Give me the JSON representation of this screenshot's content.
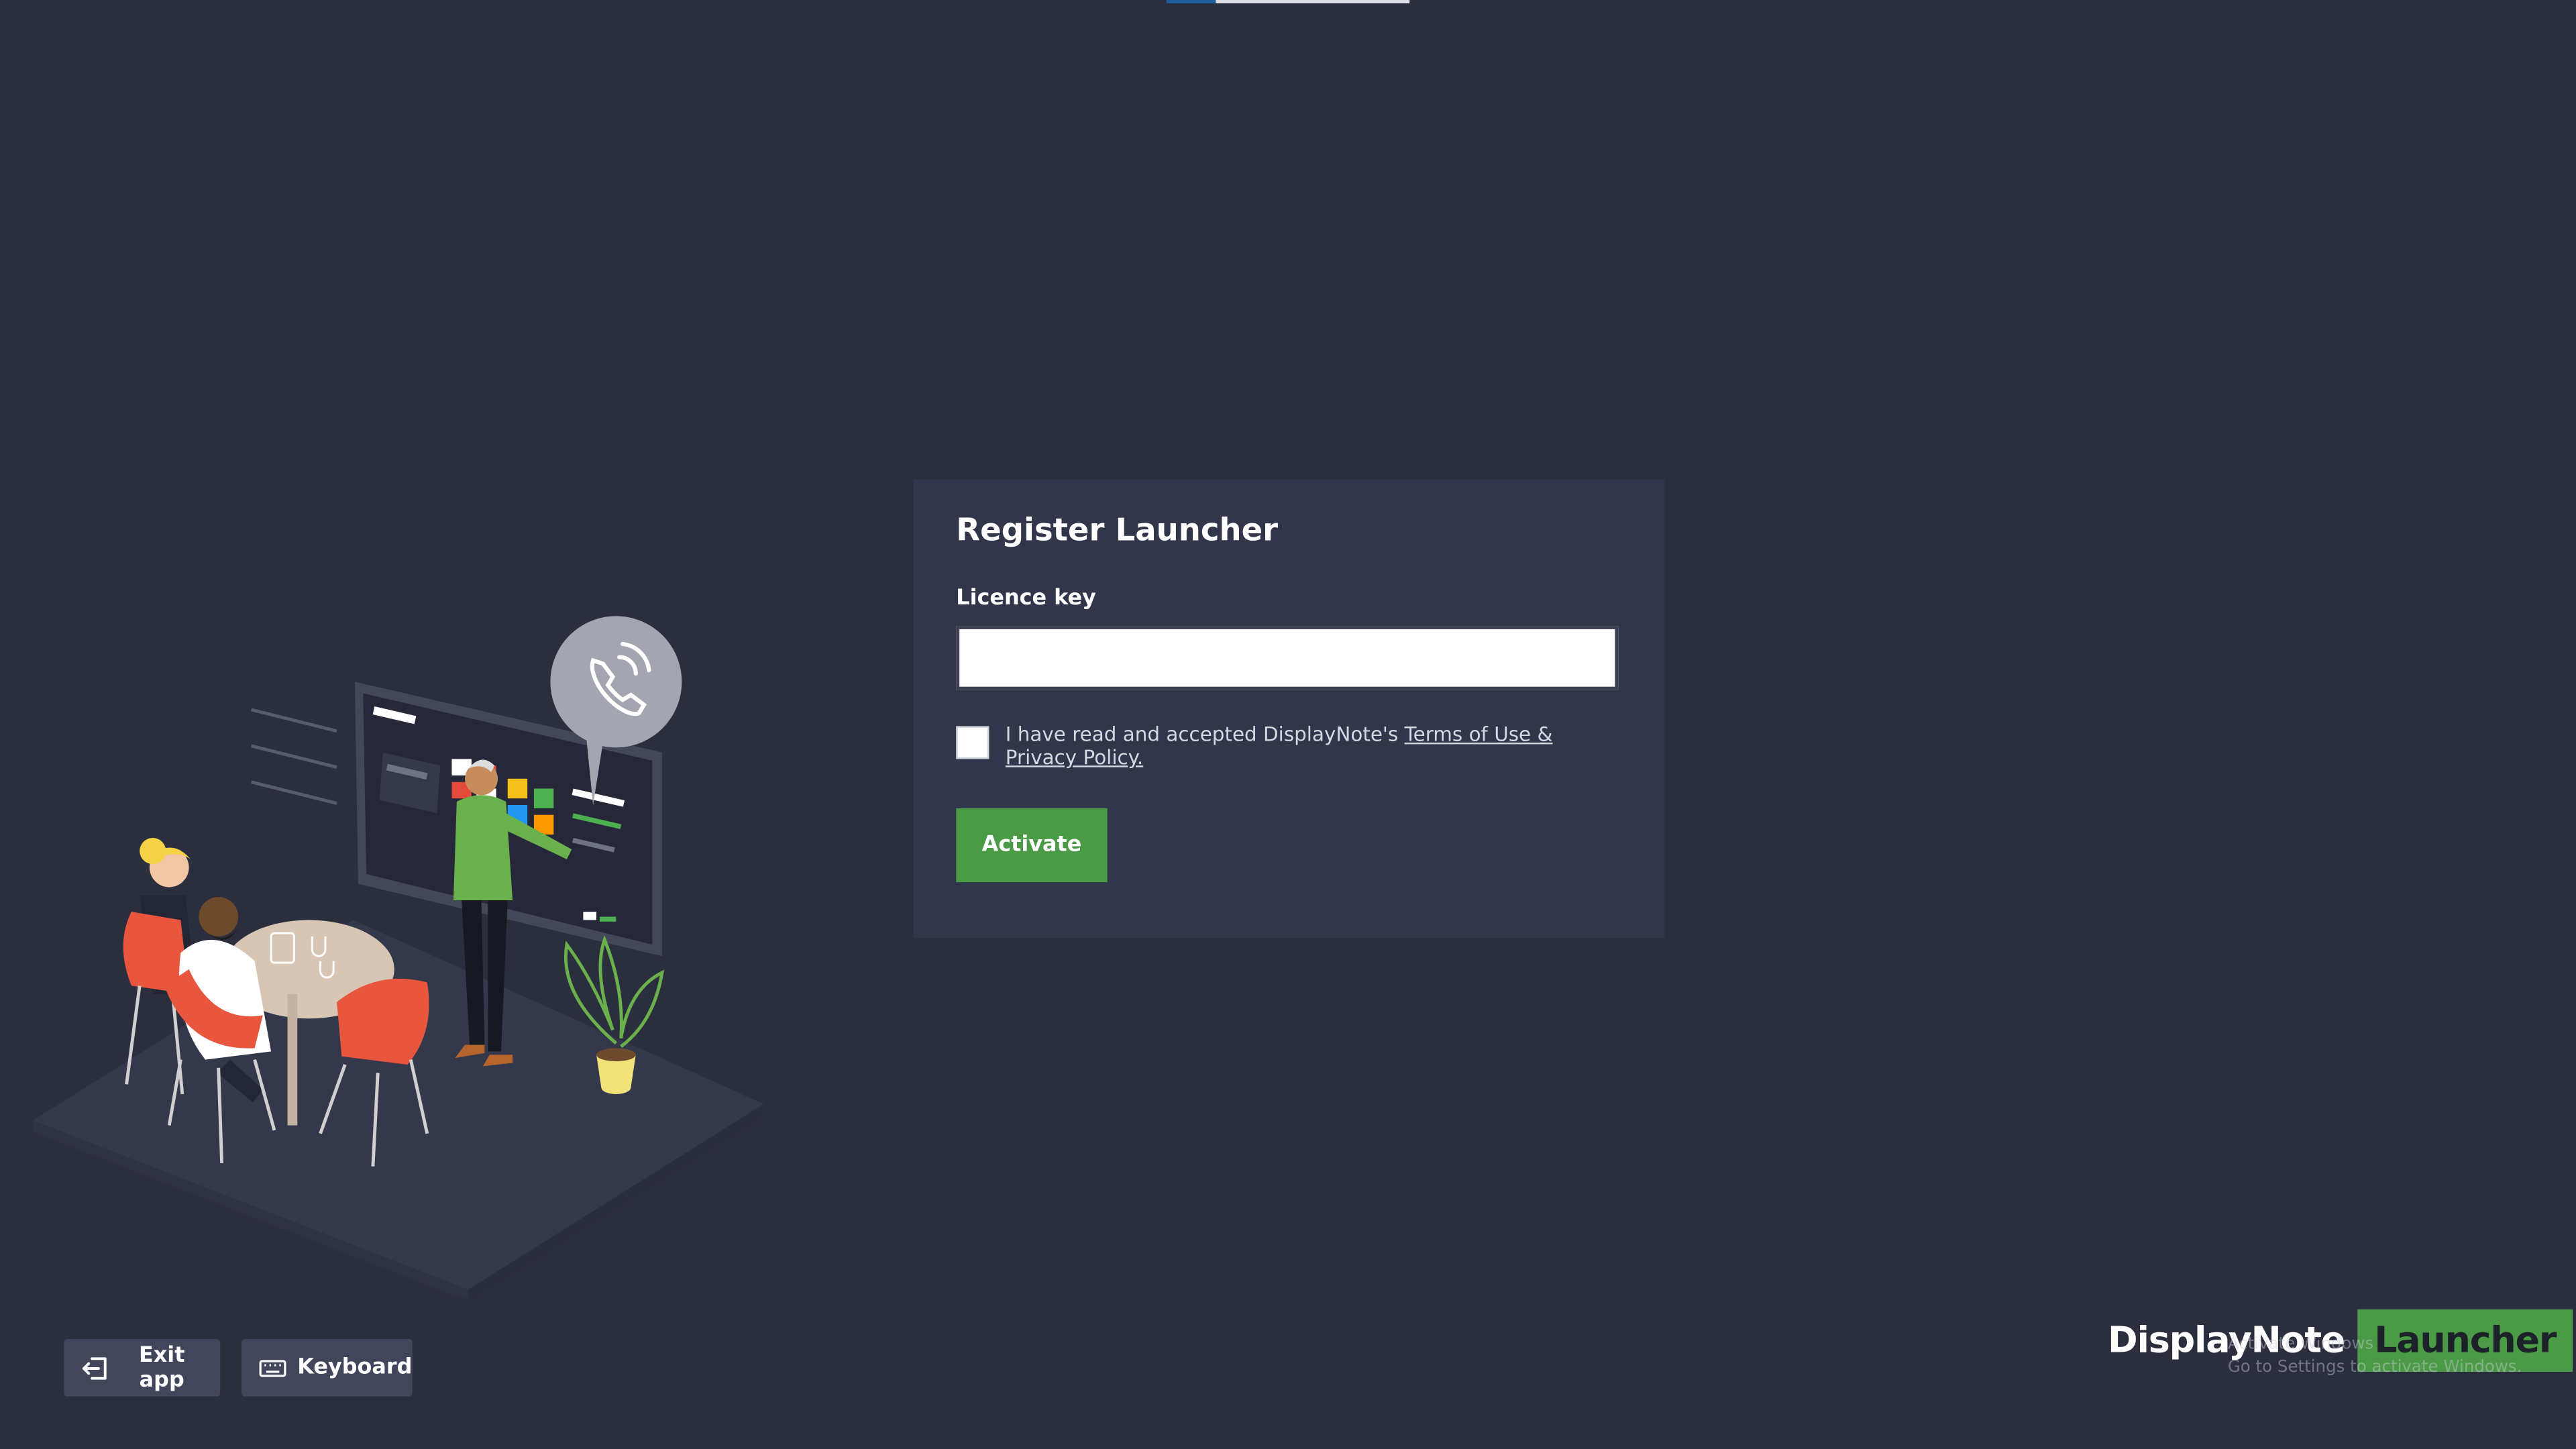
{
  "card": {
    "title": "Register Launcher",
    "licence_label": "Licence key",
    "licence_value": "",
    "licence_placeholder": "",
    "terms_prefix": "I have read and accepted DisplayNote's ",
    "terms_link": "Terms of Use & Privacy Policy.",
    "activate_label": "Activate",
    "terms_checked": false
  },
  "footer": {
    "exit_label": "Exit app",
    "keyboard_label": "Keyboard",
    "exit_icon": "exit-icon",
    "keyboard_icon": "keyboard-icon"
  },
  "brand": {
    "name": "DisplayNote",
    "tag": "Launcher"
  },
  "watermark": {
    "line1": "Activate Windows",
    "line2": "Go to Settings to activate Windows."
  },
  "illustration": {
    "icon": "phone-call-icon"
  },
  "colors": {
    "background": "#2b2e3d",
    "card": "#32364a",
    "accent_green": "#4a9a46",
    "button_grey": "#41465a"
  }
}
